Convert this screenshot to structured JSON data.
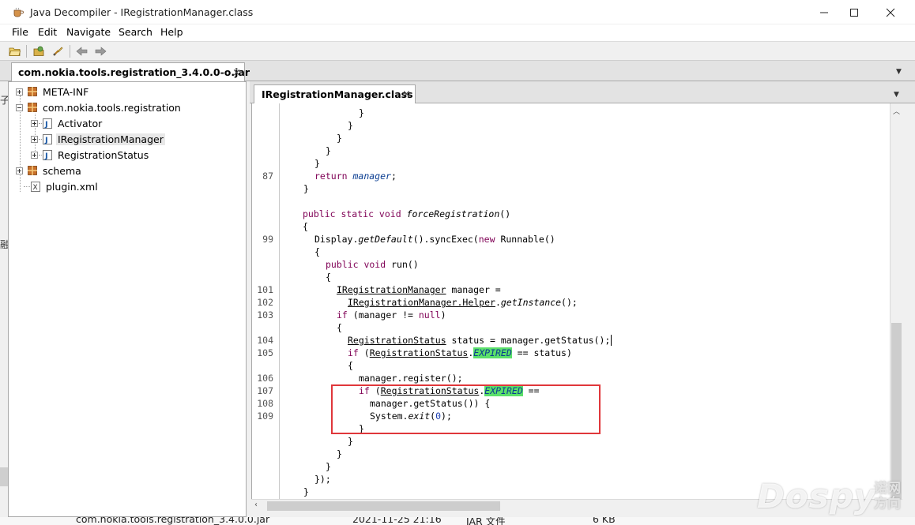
{
  "window": {
    "title": "Java Decompiler - IRegistrationManager.class"
  },
  "menu": [
    "File",
    "Edit",
    "Navigate",
    "Search",
    "Help"
  ],
  "icons": {
    "app": "coffee-cup-icon",
    "open": "folder-open-icon",
    "open_type": "open-type-icon",
    "search": "search-icon",
    "back": "arrow-left-icon",
    "forward": "arrow-right-icon",
    "package": "package-icon",
    "class": "java-class-icon",
    "xml": "xml-file-icon"
  },
  "archive_tab": {
    "label": "com.nokia.tools.registration_3.4.0.0-o.jar",
    "close": "×"
  },
  "tree": {
    "nodes": [
      {
        "label": "META-INF"
      },
      {
        "label": "com.nokia.tools.registration"
      },
      {
        "label": "Activator"
      },
      {
        "label": "IRegistrationManager"
      },
      {
        "label": "RegistrationStatus"
      },
      {
        "label": "schema"
      },
      {
        "label": "plugin.xml"
      }
    ]
  },
  "editor_tab": {
    "label": "IRegistrationManager.class",
    "close": "×"
  },
  "editor": {
    "line_numbers": [
      "87",
      "99",
      "101",
      "102",
      "103",
      "104",
      "105",
      "106",
      "107",
      "108",
      "109"
    ]
  },
  "side_strip": {
    "chars": [
      "子",
      "融"
    ]
  },
  "bottom_strip": {
    "file": "com.nokia.tools.registration_3.4.0.0.jar",
    "date": "2021-11-25 21:16",
    "type": "JAR 文件",
    "size": "6 KB"
  },
  "watermark": {
    "text": "Dospy",
    "cn": "诺网方向"
  },
  "colors": {
    "keyword": "#7f0055",
    "highlight": "#5be06a",
    "annotation": "#e0373b"
  }
}
